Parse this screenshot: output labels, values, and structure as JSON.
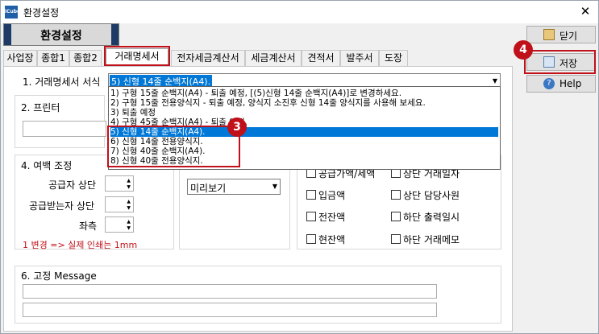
{
  "window": {
    "title": "환경설정",
    "app_icon": "iCube"
  },
  "banner": {
    "title": "환경설정"
  },
  "tabs": [
    {
      "label": "사업장"
    },
    {
      "label": "종합1"
    },
    {
      "label": "종합2"
    },
    {
      "label": "거래명세서",
      "active": true
    },
    {
      "label": "전자세금계산서"
    },
    {
      "label": "세금계산서"
    },
    {
      "label": "견적서"
    },
    {
      "label": "발주서"
    },
    {
      "label": "도장"
    }
  ],
  "sections": {
    "format": {
      "label": "1. 거래명세서 서식",
      "selected": "5) 신형 14줄 순백지(A4)."
    },
    "printer": {
      "label": "2. 프린터"
    },
    "margin": {
      "label": "4. 여백 조정",
      "supplier_top": "공급자 상단",
      "receiver_top": "공급받는자 상단",
      "left": "좌측",
      "note": "1 변경 => 실제 인쇄는 1mm"
    },
    "preview": {
      "value": "미리보기"
    },
    "message": {
      "label": "6. 고정 Message"
    }
  },
  "dropdown_options": [
    "1) 구형 15줄 순백지(A4) - 퇴출 예정, [(5)신형 14줄 순백지(A4)]로 변경하세요.",
    "2) 구형 15줄 전용양식지 - 퇴출 예정, 양식지 소진후 신형 14줄 양식지를 사용해 보세요.",
    "3) 퇴출 예정",
    "4) 구형 45줄 순백지(A4) - 퇴출 예정.",
    "5) 신형 14줄 순백지(A4).",
    "6) 신형 14줄 전용양식지.",
    "7) 신형 40줄 순백지(A4).",
    "8) 신형 40줄 전용양식지."
  ],
  "checkboxes": {
    "left": [
      "공급가액/세액",
      "입금액",
      "전잔액",
      "현잔액"
    ],
    "right": [
      "상단 거래일자",
      "상단 담당사원",
      "하단 출력일시",
      "하단 거래메모"
    ]
  },
  "buttons": {
    "close": "닫기",
    "save": "저장",
    "help": "Help"
  },
  "badges": {
    "dropdown_step": "3",
    "save_step": "4"
  },
  "colors": {
    "highlight": "#0078d7",
    "annotation_red": "#c0101a",
    "banner_dark": "#1d3b66"
  }
}
